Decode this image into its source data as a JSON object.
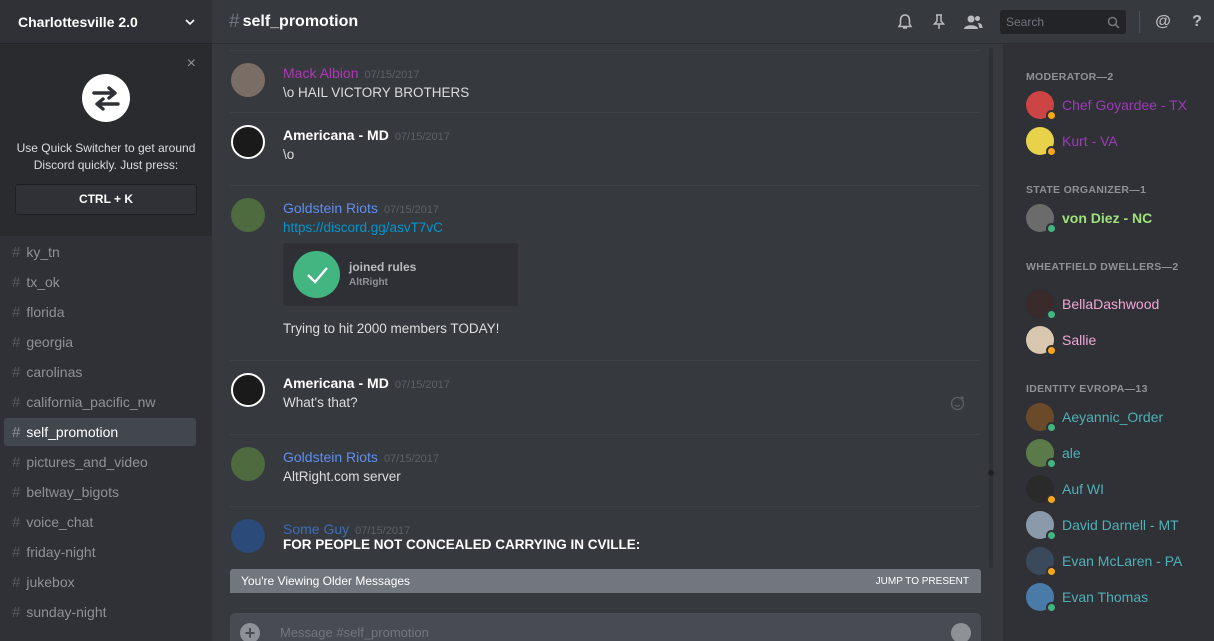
{
  "server": {
    "name": "Charlottesville 2.0"
  },
  "switcher": {
    "text": "Use Quick Switcher to get around Discord quickly. Just press:",
    "shortcut": "CTRL + K",
    "close": "×"
  },
  "channels": [
    {
      "name": "ky_tn",
      "active": false
    },
    {
      "name": "tx_ok",
      "active": false
    },
    {
      "name": "florida",
      "active": false
    },
    {
      "name": "georgia",
      "active": false
    },
    {
      "name": "carolinas",
      "active": false
    },
    {
      "name": "california_pacific_nw",
      "active": false
    },
    {
      "name": "self_promotion",
      "active": true
    },
    {
      "name": "pictures_and_video",
      "active": false
    },
    {
      "name": "beltway_bigots",
      "active": false
    },
    {
      "name": "voice_chat",
      "active": false
    },
    {
      "name": "friday-night",
      "active": false
    },
    {
      "name": "jukebox",
      "active": false
    },
    {
      "name": "sunday-night",
      "active": false
    }
  ],
  "header": {
    "hash": "#",
    "channel": "self_promotion",
    "search_placeholder": "Search",
    "icons": [
      "bell-icon",
      "pin-icon",
      "members-icon",
      "search-icon",
      "at-icon",
      "help-icon"
    ],
    "at": "@",
    "help": "?"
  },
  "messages": [
    {
      "author": "Mack Albion",
      "color": "#b137b8",
      "ts": "07/15/2017",
      "text": "\\o HAIL VICTORY BROTHERS"
    },
    {
      "author": "Americana - MD",
      "color": "#ffffff",
      "ts": "07/15/2017",
      "text": "\\o"
    },
    {
      "author": "Goldstein Riots",
      "color": "#5d8ff0",
      "ts": "07/15/2017",
      "link": "https://discord.gg/asvT7vC",
      "embed": {
        "title": "joined rules",
        "sub": "AltRight"
      },
      "text": "Trying to hit 2000 members TODAY!"
    },
    {
      "author": "Americana - MD",
      "color": "#ffffff",
      "ts": "07/15/2017",
      "text": "What's that?"
    },
    {
      "author": "Goldstein Riots",
      "color": "#5d8ff0",
      "ts": "07/15/2017",
      "text": "AltRight.com server"
    },
    {
      "author": "Some Guy",
      "color": "#3b6eb5",
      "ts": "07/15/2017",
      "text": "FOR PEOPLE NOT CONCEALED CARRYING IN CVILLE:"
    }
  ],
  "older_bar": {
    "text": "You're Viewing Older Messages",
    "jump": "JUMP TO PRESENT"
  },
  "composer": {
    "placeholder": "Message #self_promotion",
    "plus": "+"
  },
  "roles": [
    {
      "name": "MODERATOR—2",
      "members": [
        {
          "name": "Chef Goyardee - TX",
          "color": "#9b3bb5",
          "status": "idle"
        },
        {
          "name": "Kurt - VA",
          "color": "#9b3bb5",
          "status": "idle"
        }
      ]
    },
    {
      "name": "STATE ORGANIZER—1",
      "members": [
        {
          "name": "von Diez - NC",
          "color": "#9de27b",
          "status": "online"
        }
      ]
    },
    {
      "name": "WHEATFIELD DWELLERS—2",
      "members": [
        {
          "name": "BellaDashwood",
          "color": "#f1a5d6",
          "status": "online"
        },
        {
          "name": "Sallie",
          "color": "#f1a5d6",
          "status": "idle"
        }
      ]
    },
    {
      "name": "IDENTITY EVROPA—13",
      "members": [
        {
          "name": "Aeyannic_Order",
          "color": "#4fb0b8",
          "status": "online"
        },
        {
          "name": "ale",
          "color": "#4fb0b8",
          "status": "online"
        },
        {
          "name": "Auf WI",
          "color": "#4fb0b8",
          "status": "idle"
        },
        {
          "name": "David Darnell - MT",
          "color": "#4fb0b8",
          "status": "online"
        },
        {
          "name": "Evan McLaren - PA",
          "color": "#4fb0b8",
          "status": "idle"
        },
        {
          "name": "Evan Thomas",
          "color": "#4fb0b8",
          "status": "online"
        }
      ]
    }
  ],
  "colors": {
    "online": "#43b581",
    "idle": "#faa61a",
    "accent": "#7289da"
  }
}
